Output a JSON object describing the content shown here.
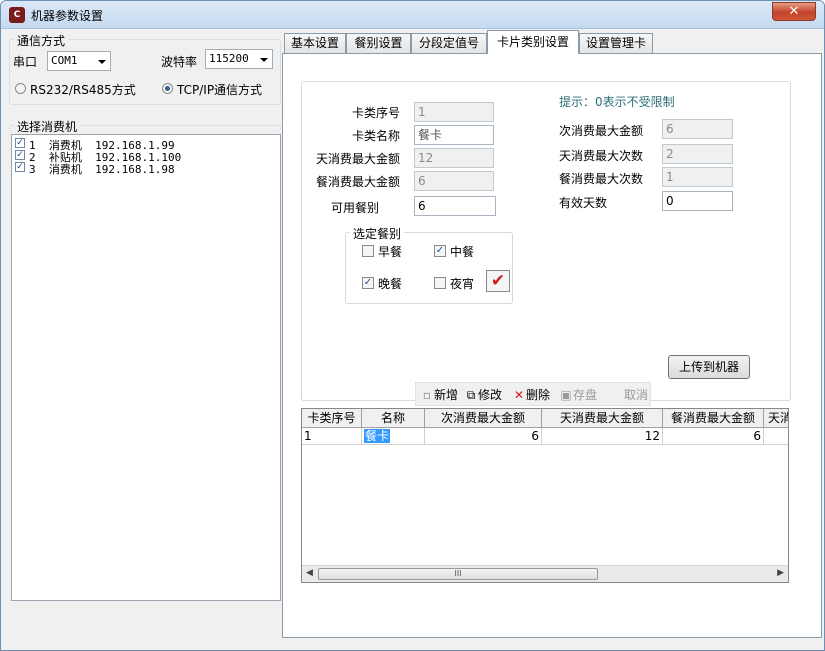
{
  "window": {
    "title": "机器参数设置",
    "close_glyph": "✕"
  },
  "comm": {
    "group_label": "通信方式",
    "port_label": "串口",
    "port_value": "COM1",
    "baud_label": "波特率",
    "baud_value": "115200",
    "mode_rs": "RS232/RS485方式",
    "mode_tcp": "TCP/IP通信方式"
  },
  "machines": {
    "group_label": "选择消费机",
    "items": [
      {
        "no": "1",
        "name": "消费机",
        "ip": "192.168.1.99",
        "checked": true
      },
      {
        "no": "2",
        "name": "补贴机",
        "ip": "192.168.1.100",
        "checked": true
      },
      {
        "no": "3",
        "name": "消费机",
        "ip": "192.168.1.98",
        "checked": true
      }
    ]
  },
  "tabs": [
    "基本设置",
    "餐别设置",
    "分段定值号",
    "卡片类别设置",
    "设置管理卡"
  ],
  "form": {
    "hint": "提示：0表示不受限制",
    "card_no_label": "卡类序号",
    "card_no": "1",
    "card_name_label": "卡类名称",
    "card_name": "餐卡",
    "day_max_amount_label": "天消费最大金额",
    "day_max_amount": "12",
    "meal_max_amount_label": "餐消费最大金额",
    "meal_max_amount": "6",
    "meals_label": "可用餐别",
    "meals": "6",
    "per_max_amount_label": "次消费最大金额",
    "per_max_amount": "6",
    "day_max_times_label": "天消费最大次数",
    "day_max_times": "2",
    "meal_max_times_label": "餐消费最大次数",
    "meal_max_times": "1",
    "valid_days_label": "有效天数",
    "valid_days": "0"
  },
  "meal_select": {
    "group_label": "选定餐别",
    "breakfast": "早餐",
    "lunch": "中餐",
    "dinner": "晚餐",
    "midnight": "夜宵",
    "checkmark": "✔"
  },
  "toolbar": {
    "add": "新增",
    "edit": "修改",
    "delete": "删除",
    "save": "存盘",
    "cancel": "取消"
  },
  "upload_button": "上传到机器",
  "grid": {
    "columns": [
      "卡类序号",
      "名称",
      "次消费最大金额",
      "天消费最大金额",
      "餐消费最大金额",
      "天消"
    ],
    "rows": [
      [
        "1",
        "餐卡",
        "6",
        "12",
        "6"
      ]
    ],
    "scroll_grip": "III"
  }
}
